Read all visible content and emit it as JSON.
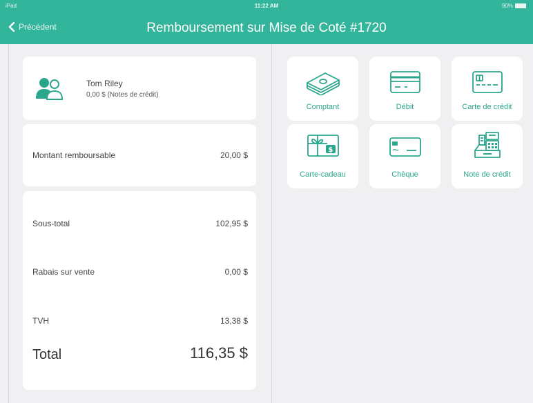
{
  "status": {
    "carrier": "iPad",
    "time": "11:22 AM",
    "battery": "90%"
  },
  "nav": {
    "back_label": "Précédent",
    "title": "Remboursement sur Mise de Coté #1720"
  },
  "customer": {
    "name": "Tom Riley",
    "credit": "0,00 $  (Notes de crédit)"
  },
  "refund": {
    "label": "Montant remboursable",
    "value": "20,00 $"
  },
  "totals": {
    "subtotal_label": "Sous-total",
    "subtotal_value": "102,95 $",
    "discount_label": "Rabais sur vente",
    "discount_value": "0,00 $",
    "tax_label": "TVH",
    "tax_value": "13,38 $",
    "total_label": "Total",
    "total_value": "116,35 $"
  },
  "payment_methods": [
    {
      "label": "Comptant",
      "icon": "cash-icon"
    },
    {
      "label": "Débit",
      "icon": "debit-card-icon"
    },
    {
      "label": "Carte de crédit",
      "icon": "credit-card-icon"
    },
    {
      "label": "Carte-cadeau",
      "icon": "gift-card-icon"
    },
    {
      "label": "Chèque",
      "icon": "cheque-icon"
    },
    {
      "label": "Note de crédit",
      "icon": "cash-register-icon"
    }
  ],
  "colors": {
    "accent": "#33b59b",
    "icon": "#2aa68d"
  }
}
